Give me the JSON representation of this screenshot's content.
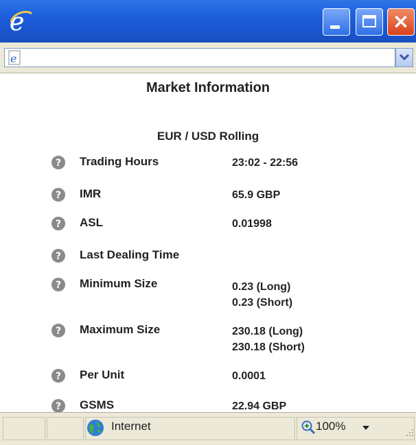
{
  "window": {
    "title": ""
  },
  "address_bar": {
    "value": ""
  },
  "page": {
    "title": "Market Information",
    "instrument": "EUR / USD Rolling",
    "rows": [
      {
        "label": "Trading Hours",
        "values": [
          "23:02 - 22:56"
        ]
      },
      {
        "label": "IMR",
        "values": [
          "65.9 GBP"
        ]
      },
      {
        "label": "ASL",
        "values": [
          "0.01998"
        ]
      },
      {
        "label": "Last Dealing Time",
        "values": []
      },
      {
        "label": "Minimum Size",
        "values": [
          "0.23 (Long)",
          "0.23 (Short)"
        ]
      },
      {
        "label": "Maximum Size",
        "values": [
          "230.18 (Long)",
          "230.18 (Short)"
        ]
      },
      {
        "label": "Per Unit",
        "values": [
          "0.0001"
        ]
      },
      {
        "label": "GSMS",
        "values": [
          "22.94 GBP"
        ]
      }
    ]
  },
  "status_bar": {
    "zone": "Internet",
    "zoom": "100%"
  },
  "icons": {
    "browser": "ie-logo-icon",
    "page": "page-icon",
    "help": "help-icon",
    "zone": "globe-icon",
    "zoom": "magnifier-icon"
  },
  "colors": {
    "titlebar": "#1e5fdc",
    "close_button": "#d8431b",
    "chrome": "#ece9d8",
    "help_icon": "#8a8a8a"
  }
}
